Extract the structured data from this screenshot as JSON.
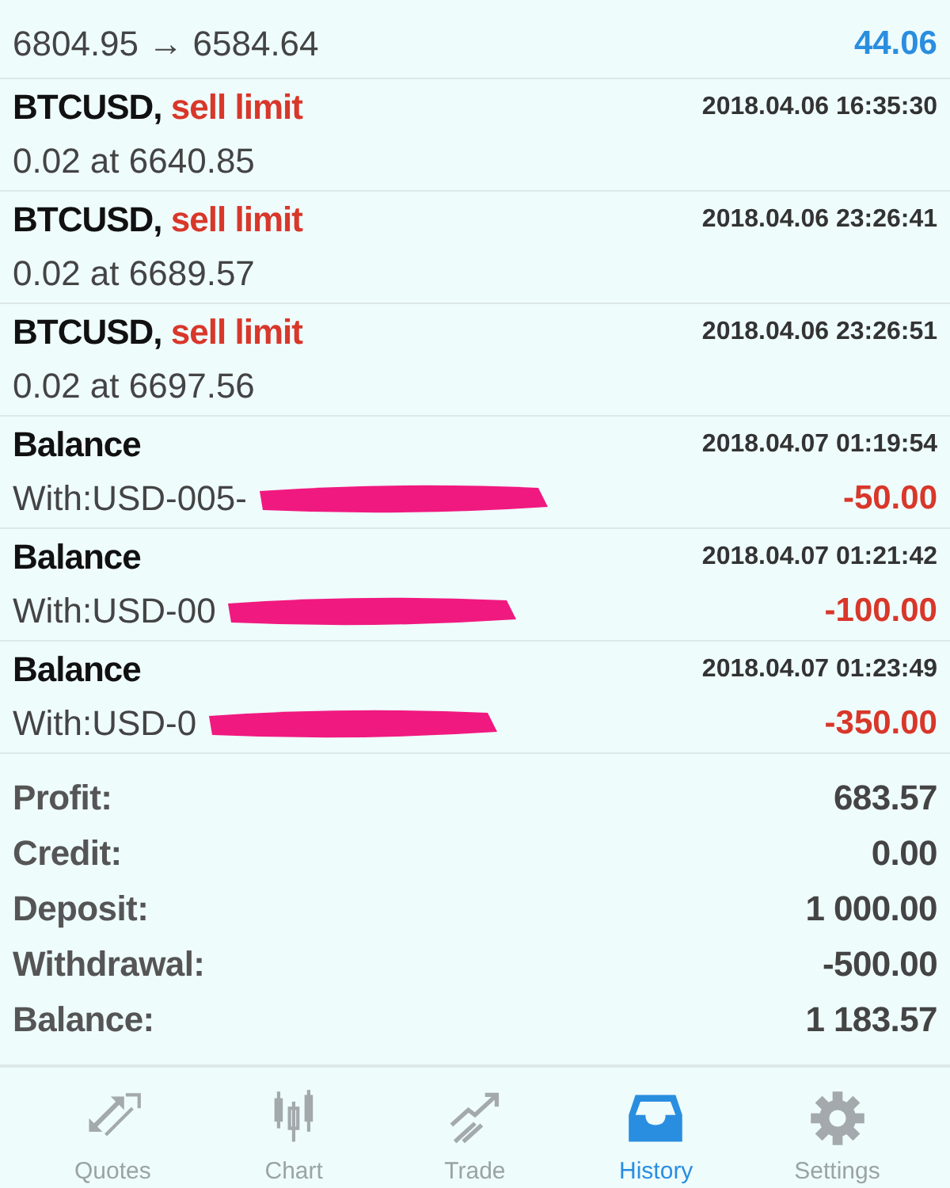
{
  "history": [
    {
      "kind": "partial",
      "detail": "6804.95 → 6584.64",
      "amount": "44.06",
      "color": "#2a8ee0"
    },
    {
      "kind": "order",
      "symbol": "BTCUSD,",
      "type": "sell limit",
      "time": "2018.04.06 16:35:30",
      "detail": "0.02 at 6640.85"
    },
    {
      "kind": "order",
      "symbol": "BTCUSD,",
      "type": "sell limit",
      "time": "2018.04.06 23:26:41",
      "detail": "0.02 at 6689.57"
    },
    {
      "kind": "order",
      "symbol": "BTCUSD,",
      "type": "sell limit",
      "time": "2018.04.06 23:26:51",
      "detail": "0.02 at 6697.56"
    },
    {
      "kind": "balance",
      "symbol": "Balance",
      "time": "2018.04.07 01:19:54",
      "detail": "With:USD-005-",
      "amount": "-50.00",
      "color": "#d8372a"
    },
    {
      "kind": "balance",
      "symbol": "Balance",
      "time": "2018.04.07 01:21:42",
      "detail": "With:USD-00",
      "amount": "-100.00",
      "color": "#d8372a"
    },
    {
      "kind": "balance",
      "symbol": "Balance",
      "time": "2018.04.07 01:23:49",
      "detail": "With:USD-0",
      "amount": "-350.00",
      "color": "#d8372a"
    }
  ],
  "summary": [
    {
      "label": "Profit:",
      "value": "683.57"
    },
    {
      "label": "Credit:",
      "value": "0.00"
    },
    {
      "label": "Deposit:",
      "value": "1 000.00"
    },
    {
      "label": "Withdrawal:",
      "value": "-500.00"
    },
    {
      "label": "Balance:",
      "value": "1 183.57"
    }
  ],
  "tabs": [
    {
      "label": "Quotes",
      "selected": false
    },
    {
      "label": "Chart",
      "selected": false
    },
    {
      "label": "Trade",
      "selected": false
    },
    {
      "label": "History",
      "selected": true
    },
    {
      "label": "Settings",
      "selected": false
    }
  ]
}
